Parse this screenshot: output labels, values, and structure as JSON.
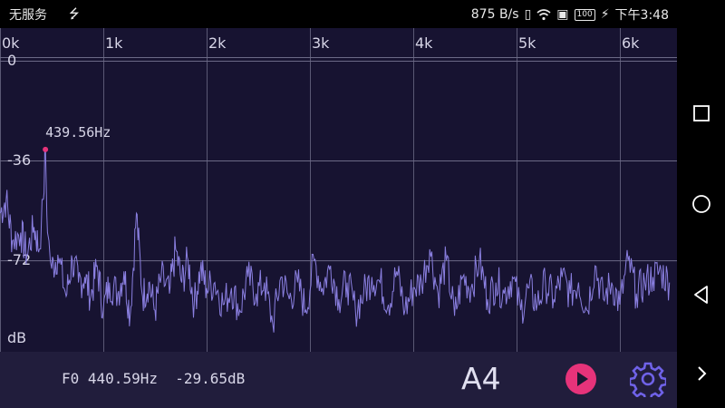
{
  "status_bar": {
    "carrier": "无服务",
    "usb_icon": "usb-icon",
    "net_speed": "875 B/s",
    "vibrate_icon": "vibrate-icon",
    "wifi_icon": "wifi-icon",
    "sim_icon": "sim-icon",
    "battery": "100",
    "charging_icon": "charging-icon",
    "time": "下午3:48"
  },
  "spectrum": {
    "x_ticks": [
      "0k",
      "1k",
      "2k",
      "3k",
      "4k",
      "5k",
      "6k"
    ],
    "y_ticks": [
      "0",
      "-36",
      "-72"
    ],
    "y_unit": "dB",
    "peak_label": "439.56Hz",
    "peak": {
      "freq_hz": 439.56,
      "db": -32
    },
    "line_color": "#8a7fe0",
    "peak_marker_color": "#e6337a",
    "background_color": "#171331"
  },
  "chart_data": {
    "type": "line",
    "title": "",
    "xlabel": "",
    "ylabel": "dB",
    "x_tick_labels": [
      "0k",
      "1k",
      "2k",
      "3k",
      "4k",
      "5k",
      "6k"
    ],
    "y_tick_labels": [
      "0",
      "-36",
      "-72"
    ],
    "xlim": [
      0,
      6500
    ],
    "ylim": [
      -105,
      0
    ],
    "grid": true,
    "series": [
      {
        "x": [
          0,
          60,
          120,
          200,
          260,
          330,
          380,
          420,
          440,
          460,
          500,
          560,
          640,
          700,
          760,
          820,
          880,
          940,
          1000,
          1060,
          1140,
          1200,
          1260,
          1320,
          1380,
          1440,
          1500,
          1560,
          1640,
          1700,
          1760,
          1820,
          1880,
          1940,
          2000,
          2080,
          2160,
          2240,
          2320,
          2400,
          2480,
          2560,
          2640,
          2720,
          2800,
          2880,
          2960,
          3040,
          3120,
          3200,
          3280,
          3360,
          3440,
          3520,
          3600,
          3680,
          3760,
          3840,
          3920,
          4000,
          4080,
          4160,
          4240,
          4320,
          4400,
          4480,
          4560,
          4640,
          4720,
          4800,
          4880,
          4960,
          5040,
          5120,
          5200,
          5280,
          5360,
          5440,
          5520,
          5600,
          5680,
          5760,
          5840,
          5920,
          6000,
          6080,
          6160,
          6240,
          6320,
          6400,
          6480
        ],
        "y": [
          -55,
          -50,
          -65,
          -62,
          -70,
          -60,
          -68,
          -50,
          -32,
          -62,
          -75,
          -70,
          -85,
          -72,
          -80,
          -78,
          -85,
          -74,
          -90,
          -80,
          -84,
          -76,
          -92,
          -55,
          -85,
          -80,
          -90,
          -78,
          -84,
          -68,
          -80,
          -72,
          -88,
          -75,
          -82,
          -80,
          -88,
          -82,
          -90,
          -78,
          -84,
          -80,
          -95,
          -78,
          -86,
          -80,
          -90,
          -72,
          -82,
          -74,
          -86,
          -80,
          -90,
          -84,
          -78,
          -80,
          -88,
          -76,
          -90,
          -82,
          -80,
          -68,
          -84,
          -72,
          -92,
          -78,
          -82,
          -72,
          -86,
          -80,
          -84,
          -78,
          -90,
          -82,
          -88,
          -80,
          -86,
          -78,
          -84,
          -80,
          -90,
          -74,
          -86,
          -80,
          -88,
          -72,
          -84,
          -80,
          -78,
          -76,
          -80
        ]
      }
    ],
    "annotations": [
      "439.56Hz"
    ]
  },
  "bottom_bar": {
    "f0_label": "F0",
    "f0_freq": "440.59Hz",
    "f0_db": "-29.65dB",
    "note": "A4",
    "play_icon": "play-icon",
    "settings_icon": "gear-icon"
  },
  "nav_bar": {
    "recents_icon": "square-icon",
    "home_icon": "circle-icon",
    "back_icon": "triangle-back-icon",
    "expand_icon": "chevron-right-icon"
  }
}
